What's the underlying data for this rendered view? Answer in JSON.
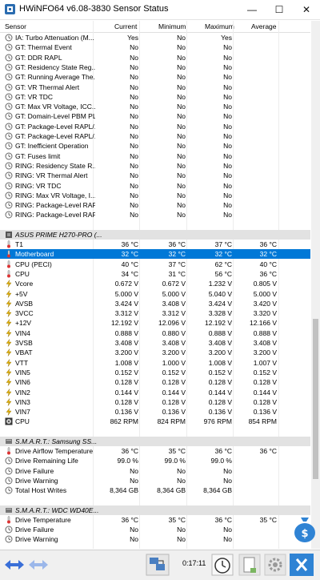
{
  "window": {
    "title": "HWiNFO64 v6.08-3830 Sensor Status",
    "minimize": "—",
    "maximize": "☐",
    "close": "✕"
  },
  "columns": [
    "Sensor",
    "Current",
    "Minimum",
    "Maximum",
    "Average"
  ],
  "rows": [
    {
      "type": "item",
      "icon": "clock",
      "name": "IA: Turbo Attenuation (M...",
      "cur": "Yes",
      "min": "No",
      "max": "Yes",
      "avg": ""
    },
    {
      "type": "item",
      "icon": "clock",
      "name": "GT: Thermal Event",
      "cur": "No",
      "min": "No",
      "max": "No",
      "avg": ""
    },
    {
      "type": "item",
      "icon": "clock",
      "name": "GT: DDR RAPL",
      "cur": "No",
      "min": "No",
      "max": "No",
      "avg": ""
    },
    {
      "type": "item",
      "icon": "clock",
      "name": "GT: Residency State Reg...",
      "cur": "No",
      "min": "No",
      "max": "No",
      "avg": ""
    },
    {
      "type": "item",
      "icon": "clock",
      "name": "GT: Running Average The...",
      "cur": "No",
      "min": "No",
      "max": "No",
      "avg": ""
    },
    {
      "type": "item",
      "icon": "clock",
      "name": "GT: VR Thermal Alert",
      "cur": "No",
      "min": "No",
      "max": "No",
      "avg": ""
    },
    {
      "type": "item",
      "icon": "clock",
      "name": "GT: VR TDC",
      "cur": "No",
      "min": "No",
      "max": "No",
      "avg": ""
    },
    {
      "type": "item",
      "icon": "clock",
      "name": "GT: Max VR Voltage, ICC...",
      "cur": "No",
      "min": "No",
      "max": "No",
      "avg": ""
    },
    {
      "type": "item",
      "icon": "clock",
      "name": "GT: Domain-Level PBM PLGT",
      "cur": "No",
      "min": "No",
      "max": "No",
      "avg": ""
    },
    {
      "type": "item",
      "icon": "clock",
      "name": "GT: Package-Level RAPL/...",
      "cur": "No",
      "min": "No",
      "max": "No",
      "avg": ""
    },
    {
      "type": "item",
      "icon": "clock",
      "name": "GT: Package-Level RAPL/...",
      "cur": "No",
      "min": "No",
      "max": "No",
      "avg": ""
    },
    {
      "type": "item",
      "icon": "clock",
      "name": "GT: Inefficient Operation",
      "cur": "No",
      "min": "No",
      "max": "No",
      "avg": ""
    },
    {
      "type": "item",
      "icon": "clock",
      "name": "GT: Fuses limit",
      "cur": "No",
      "min": "No",
      "max": "No",
      "avg": ""
    },
    {
      "type": "item",
      "icon": "clock",
      "name": "RING: Residency State R...",
      "cur": "No",
      "min": "No",
      "max": "No",
      "avg": ""
    },
    {
      "type": "item",
      "icon": "clock",
      "name": "RING: VR Thermal Alert",
      "cur": "No",
      "min": "No",
      "max": "No",
      "avg": ""
    },
    {
      "type": "item",
      "icon": "clock",
      "name": "RING: VR TDC",
      "cur": "No",
      "min": "No",
      "max": "No",
      "avg": ""
    },
    {
      "type": "item",
      "icon": "clock",
      "name": "RING: Max VR Voltage, I...",
      "cur": "No",
      "min": "No",
      "max": "No",
      "avg": ""
    },
    {
      "type": "item",
      "icon": "clock",
      "name": "RING: Package-Level RAP...",
      "cur": "No",
      "min": "No",
      "max": "No",
      "avg": ""
    },
    {
      "type": "item",
      "icon": "clock",
      "name": "RING: Package-Level RAP...",
      "cur": "No",
      "min": "No",
      "max": "No",
      "avg": ""
    },
    {
      "type": "spacer"
    },
    {
      "type": "group",
      "icon": "chip",
      "name": "ASUS PRIME H270-PRO (..."
    },
    {
      "type": "item",
      "icon": "thermo",
      "name": "T1",
      "cur": "36 °C",
      "min": "36 °C",
      "max": "37 °C",
      "avg": "36 °C"
    },
    {
      "type": "item",
      "icon": "thermo",
      "name": "Motherboard",
      "cur": "32 °C",
      "min": "32 °C",
      "max": "32 °C",
      "avg": "32 °C",
      "selected": true
    },
    {
      "type": "item",
      "icon": "thermo",
      "name": "CPU (PECI)",
      "cur": "40 °C",
      "min": "37 °C",
      "max": "62 °C",
      "avg": "40 °C"
    },
    {
      "type": "item",
      "icon": "thermo",
      "name": "CPU",
      "cur": "34 °C",
      "min": "31 °C",
      "max": "56 °C",
      "avg": "36 °C"
    },
    {
      "type": "item",
      "icon": "bolt",
      "name": "Vcore",
      "cur": "0.672 V",
      "min": "0.672 V",
      "max": "1.232 V",
      "avg": "0.805 V"
    },
    {
      "type": "item",
      "icon": "bolt",
      "name": "+5V",
      "cur": "5.000 V",
      "min": "5.000 V",
      "max": "5.040 V",
      "avg": "5.000 V"
    },
    {
      "type": "item",
      "icon": "bolt",
      "name": "AVSB",
      "cur": "3.424 V",
      "min": "3.408 V",
      "max": "3.424 V",
      "avg": "3.420 V"
    },
    {
      "type": "item",
      "icon": "bolt",
      "name": "3VCC",
      "cur": "3.312 V",
      "min": "3.312 V",
      "max": "3.328 V",
      "avg": "3.320 V"
    },
    {
      "type": "item",
      "icon": "bolt",
      "name": "+12V",
      "cur": "12.192 V",
      "min": "12.096 V",
      "max": "12.192 V",
      "avg": "12.166 V"
    },
    {
      "type": "item",
      "icon": "bolt",
      "name": "VIN4",
      "cur": "0.888 V",
      "min": "0.880 V",
      "max": "0.888 V",
      "avg": "0.888 V"
    },
    {
      "type": "item",
      "icon": "bolt",
      "name": "3VSB",
      "cur": "3.408 V",
      "min": "3.408 V",
      "max": "3.408 V",
      "avg": "3.408 V"
    },
    {
      "type": "item",
      "icon": "bolt",
      "name": "VBAT",
      "cur": "3.200 V",
      "min": "3.200 V",
      "max": "3.200 V",
      "avg": "3.200 V"
    },
    {
      "type": "item",
      "icon": "bolt",
      "name": "VTT",
      "cur": "1.008 V",
      "min": "1.000 V",
      "max": "1.008 V",
      "avg": "1.007 V"
    },
    {
      "type": "item",
      "icon": "bolt",
      "name": "VIN5",
      "cur": "0.152 V",
      "min": "0.152 V",
      "max": "0.152 V",
      "avg": "0.152 V"
    },
    {
      "type": "item",
      "icon": "bolt",
      "name": "VIN6",
      "cur": "0.128 V",
      "min": "0.128 V",
      "max": "0.128 V",
      "avg": "0.128 V"
    },
    {
      "type": "item",
      "icon": "bolt",
      "name": "VIN2",
      "cur": "0.144 V",
      "min": "0.144 V",
      "max": "0.144 V",
      "avg": "0.144 V"
    },
    {
      "type": "item",
      "icon": "bolt",
      "name": "VIN3",
      "cur": "0.128 V",
      "min": "0.128 V",
      "max": "0.128 V",
      "avg": "0.128 V"
    },
    {
      "type": "item",
      "icon": "bolt",
      "name": "VIN7",
      "cur": "0.136 V",
      "min": "0.136 V",
      "max": "0.136 V",
      "avg": "0.136 V"
    },
    {
      "type": "item",
      "icon": "fan",
      "name": "CPU",
      "cur": "862 RPM",
      "min": "824 RPM",
      "max": "976 RPM",
      "avg": "854 RPM"
    },
    {
      "type": "spacer"
    },
    {
      "type": "group",
      "icon": "disk",
      "name": "S.M.A.R.T.: Samsung SS..."
    },
    {
      "type": "item",
      "icon": "thermo",
      "name": "Drive Airflow Temperature",
      "cur": "36 °C",
      "min": "35 °C",
      "max": "36 °C",
      "avg": "36 °C"
    },
    {
      "type": "item",
      "icon": "clock",
      "name": "Drive Remaining Life",
      "cur": "99.0 %",
      "min": "99.0 %",
      "max": "99.0 %",
      "avg": ""
    },
    {
      "type": "item",
      "icon": "clock",
      "name": "Drive Failure",
      "cur": "No",
      "min": "No",
      "max": "No",
      "avg": ""
    },
    {
      "type": "item",
      "icon": "clock",
      "name": "Drive Warning",
      "cur": "No",
      "min": "No",
      "max": "No",
      "avg": ""
    },
    {
      "type": "item",
      "icon": "clock",
      "name": "Total Host Writes",
      "cur": "8,364 GB",
      "min": "8,364 GB",
      "max": "8,364 GB",
      "avg": ""
    },
    {
      "type": "spacer"
    },
    {
      "type": "group",
      "icon": "disk",
      "name": "S.M.A.R.T.: WDC WD40E..."
    },
    {
      "type": "item",
      "icon": "thermo",
      "name": "Drive Temperature",
      "cur": "36 °C",
      "min": "35 °C",
      "max": "36 °C",
      "avg": "35 °C"
    },
    {
      "type": "item",
      "icon": "clock",
      "name": "Drive Failure",
      "cur": "No",
      "min": "No",
      "max": "No",
      "avg": ""
    },
    {
      "type": "item",
      "icon": "clock",
      "name": "Drive Warning",
      "cur": "No",
      "min": "No",
      "max": "No",
      "avg": ""
    }
  ],
  "toolbar": {
    "elapsed": "0:17:11",
    "icons": [
      "nav-arrows-icon",
      "nav-arrows-disabled-icon",
      "network-computers-icon",
      "stopwatch-icon",
      "report-icon",
      "settings-gear-icon",
      "close-x-icon"
    ]
  },
  "colors": {
    "selection": "#0078d7",
    "group_bg": "#e2e2e2",
    "toolbar_bg": "#f0f0f0",
    "close_button": "#2f83d4"
  }
}
